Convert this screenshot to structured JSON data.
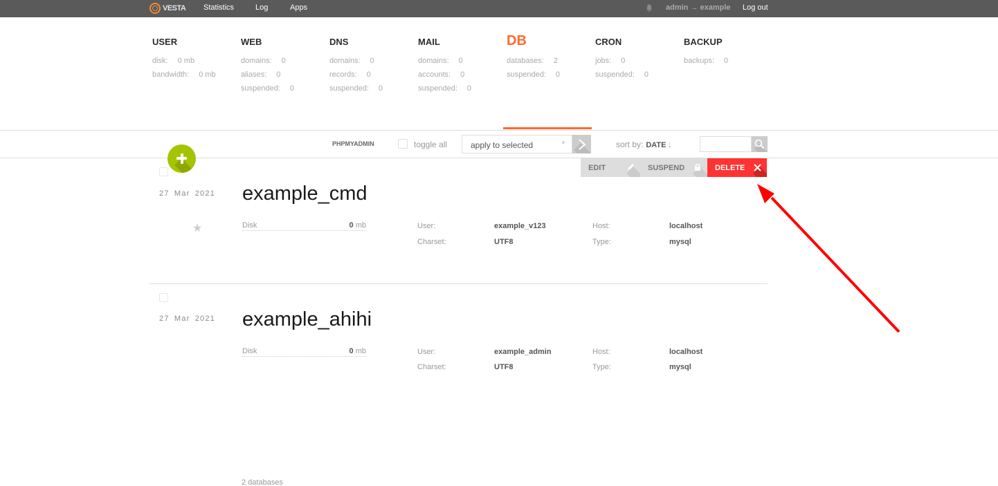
{
  "topbar": {
    "logo_text": "VESTA",
    "nav": [
      {
        "label": "Statistics"
      },
      {
        "label": "Log"
      },
      {
        "label": "Apps"
      }
    ],
    "user_switch": "admin → example",
    "logout_label": "Log out",
    "icons": {
      "bell": "bell-icon"
    }
  },
  "stats": {
    "user": {
      "title": "USER",
      "rows": [
        {
          "label": "disk:",
          "value": "0 mb"
        },
        {
          "label": "bandwidth:",
          "value": "0 mb"
        }
      ]
    },
    "web": {
      "title": "WEB",
      "rows": [
        {
          "label": "domains:",
          "value": "0"
        },
        {
          "label": "aliases:",
          "value": "0"
        },
        {
          "label": "suspended:",
          "value": "0"
        }
      ]
    },
    "dns": {
      "title": "DNS",
      "rows": [
        {
          "label": "domains:",
          "value": "0"
        },
        {
          "label": "records:",
          "value": "0"
        },
        {
          "label": "suspended:",
          "value": "0"
        }
      ]
    },
    "mail": {
      "title": "MAIL",
      "rows": [
        {
          "label": "domains:",
          "value": "0"
        },
        {
          "label": "accounts:",
          "value": "0"
        },
        {
          "label": "suspended:",
          "value": "0"
        }
      ]
    },
    "db": {
      "title": "DB",
      "active": true,
      "rows": [
        {
          "label": "databases:",
          "value": "2"
        },
        {
          "label": "suspended:",
          "value": "0"
        }
      ]
    },
    "cron": {
      "title": "CRON",
      "rows": [
        {
          "label": "jobs:",
          "value": "0"
        },
        {
          "label": "suspended:",
          "value": "0"
        }
      ]
    },
    "backup": {
      "title": "BACKUP",
      "rows": [
        {
          "label": "backups:",
          "value": "0"
        }
      ]
    }
  },
  "toolbar": {
    "phpmyadmin_label": "PHPMYADMIN",
    "toggle_all_label": "toggle all",
    "bulk_action_selected": "apply to selected",
    "sort_by_label": "sort by:",
    "sort_by_value": "DATE",
    "sort_direction_glyph": "↓",
    "search_value": ""
  },
  "row_actions": {
    "edit_label": "EDIT",
    "suspend_label": "SUSPEND",
    "delete_label": "DELETE"
  },
  "databases": [
    {
      "date": "27 Mar 2021",
      "name": "example_cmd",
      "disk_label": "Disk",
      "disk_value": "0",
      "disk_unit": "mb",
      "user_label": "User:",
      "user": "example_v123",
      "charset_label": "Charset:",
      "charset": "UTF8",
      "host_label": "Host:",
      "host": "localhost",
      "type_label": "Type:",
      "type": "mysql",
      "starred": false
    },
    {
      "date": "27 Mar 2021",
      "name": "example_ahihi",
      "disk_label": "Disk",
      "disk_value": "0",
      "disk_unit": "mb",
      "user_label": "User:",
      "user": "example_admin",
      "charset_label": "Charset:",
      "charset": "UTF8",
      "host_label": "Host:",
      "host": "localhost",
      "type_label": "Type:",
      "type": "mysql"
    }
  ],
  "footer": {
    "count_label": "2 databases"
  },
  "colors": {
    "topbar": "#5a5a5a",
    "accent": "#ff6a2b",
    "add_button": "#a5c400",
    "delete": "#ff3333",
    "annotation_arrow": "#ff0000"
  }
}
